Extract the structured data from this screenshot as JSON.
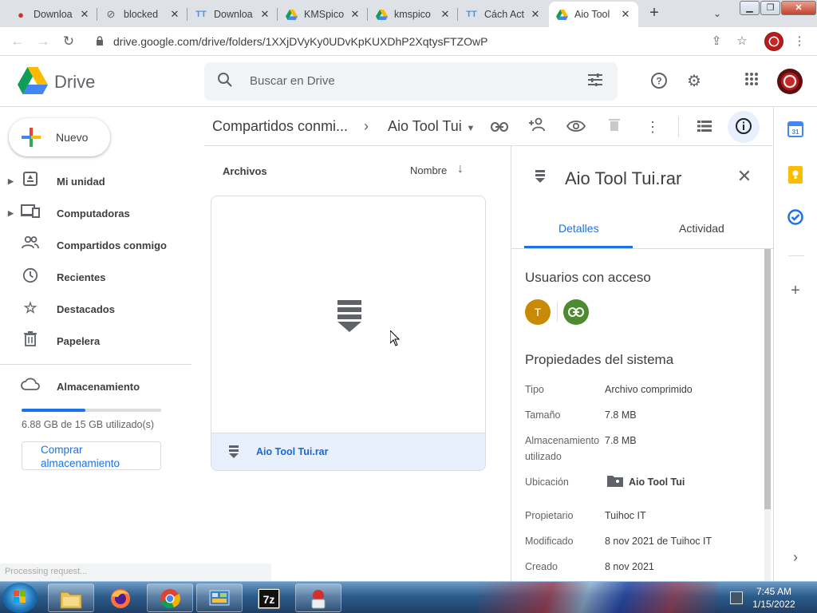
{
  "browser": {
    "tabs": [
      {
        "title": "Downloa",
        "icon": "red-circle-icon"
      },
      {
        "title": "blocked",
        "icon": "blocked-icon"
      },
      {
        "title": "Downloa",
        "icon": "tt-site-icon"
      },
      {
        "title": "KMSpico",
        "icon": "google-drive-icon"
      },
      {
        "title": "kmspico",
        "icon": "google-drive-icon"
      },
      {
        "title": "Cách Act",
        "icon": "tt-site-icon"
      },
      {
        "title": "Aio Tool",
        "icon": "google-drive-icon",
        "active": true
      }
    ],
    "url": "drive.google.com/drive/folders/1XXjDVyKy0UDvKpKUXDhP2XqtysFTZOwP"
  },
  "drive": {
    "app_name": "Drive",
    "search_placeholder": "Buscar en Drive",
    "new_button": "Nuevo",
    "nav": [
      {
        "label": "Mi unidad",
        "icon": "my-drive-icon",
        "expandable": true
      },
      {
        "label": "Computadoras",
        "icon": "computers-icon",
        "expandable": true
      },
      {
        "label": "Compartidos conmigo",
        "icon": "shared-icon",
        "expandable": false
      },
      {
        "label": "Recientes",
        "icon": "clock-icon",
        "expandable": false
      },
      {
        "label": "Destacados",
        "icon": "star-icon",
        "expandable": false
      },
      {
        "label": "Papelera",
        "icon": "trash-icon",
        "expandable": false
      }
    ],
    "storage": {
      "label": "Almacenamiento",
      "usage_text": "6.88 GB de 15 GB utilizado(s)",
      "used_fraction": 0.4587,
      "buy_line1": "Comprar",
      "buy_line2": "almacenamiento"
    },
    "status_message": "Processing request...",
    "breadcrumb": {
      "parent": "Compartidos conmi...",
      "current": "Aio Tool Tui"
    },
    "files": {
      "section_label": "Archivos",
      "sort_label": "Nombre",
      "items": [
        {
          "name": "Aio Tool Tui.rar",
          "selected": true
        }
      ]
    },
    "details": {
      "title": "Aio Tool Tui.rar",
      "tabs": [
        "Detalles",
        "Actividad"
      ],
      "active_tab": "Detalles",
      "access_heading": "Usuarios con acceso",
      "access_user_initial": "T",
      "properties_heading": "Propiedades del sistema",
      "properties": [
        {
          "key": "Tipo",
          "value": "Archivo comprimido"
        },
        {
          "key": "Tamaño",
          "value": "7.8 MB"
        },
        {
          "key": "Almacenamiento utilizado",
          "value": "7.8 MB"
        },
        {
          "key": "Ubicación",
          "value": "Aio Tool Tui"
        },
        {
          "key": "Propietario",
          "value": "Tuihoc IT"
        },
        {
          "key": "Modificado",
          "value": "8 nov 2021 de Tuihoc IT"
        },
        {
          "key": "Creado",
          "value": "8 nov 2021"
        }
      ]
    }
  },
  "taskbar": {
    "time": "7:45 AM",
    "date": "1/15/2022",
    "apps": [
      "file-explorer-icon",
      "firefox-icon",
      "chrome-icon",
      "control-panel-icon",
      "7zip-icon",
      "app-icon"
    ]
  },
  "colors": {
    "accent": "#1a73e8",
    "selected_bg": "#e8f0fe",
    "avatar_t": "#c88a04",
    "link_avatar": "#4d8b31"
  }
}
